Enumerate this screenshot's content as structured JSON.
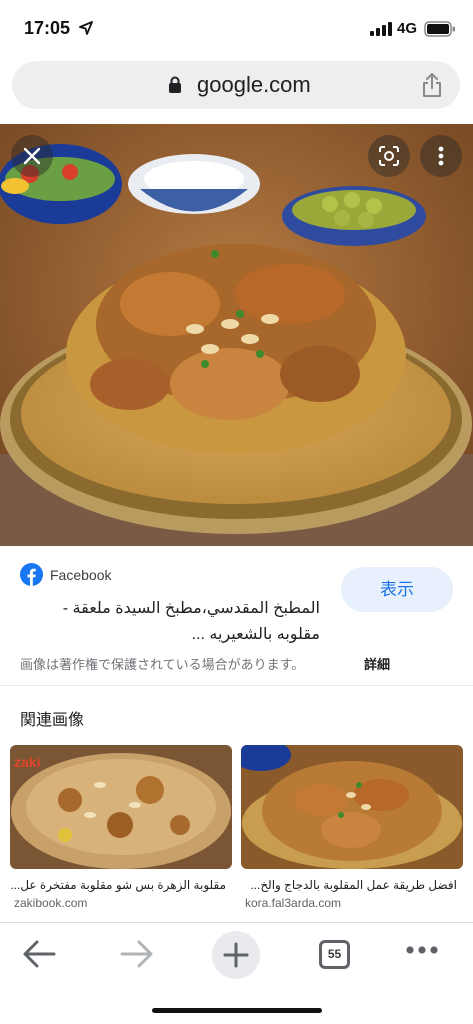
{
  "status_bar": {
    "time": "17:05",
    "network": "4G"
  },
  "address_bar": {
    "domain": "google.com"
  },
  "image_viewer": {
    "source_name": "Facebook",
    "title": "المطبخ المقدسي،مطبخ السيدة ملعقة - مقلوبه بالشعيريه ...",
    "view_button": "表示",
    "copyright_notice": "画像は著作権で保護されている場合があります。",
    "details_link": "詳細"
  },
  "related": {
    "heading": "関連画像",
    "items": [
      {
        "title": "مقلوبة الزهرة بس شو مقلوبة مفتخرة عل...",
        "url": "zakibook.com",
        "watermark": "zaki"
      },
      {
        "title": "افضل طريقة عمل المقلوبة بالدجاج والخ...",
        "url": "kora.fal3arda.com"
      }
    ]
  },
  "toolbar": {
    "tab_count": "55"
  },
  "icons": {
    "location": "location-arrow-icon",
    "signal": "signal-icon",
    "battery": "battery-icon",
    "lock": "lock-icon",
    "share": "share-icon",
    "close": "close-icon",
    "lens": "lens-icon",
    "more": "more-vertical-icon",
    "facebook": "facebook-icon",
    "back": "back-arrow-icon",
    "forward": "forward-arrow-icon",
    "new_tab": "plus-icon",
    "tabs": "tab-switcher-icon",
    "menu": "more-horizontal-icon"
  },
  "colors": {
    "accent": "#1a73e8",
    "view_button_bg": "#e8f0fe",
    "facebook_blue": "#1877f2"
  }
}
